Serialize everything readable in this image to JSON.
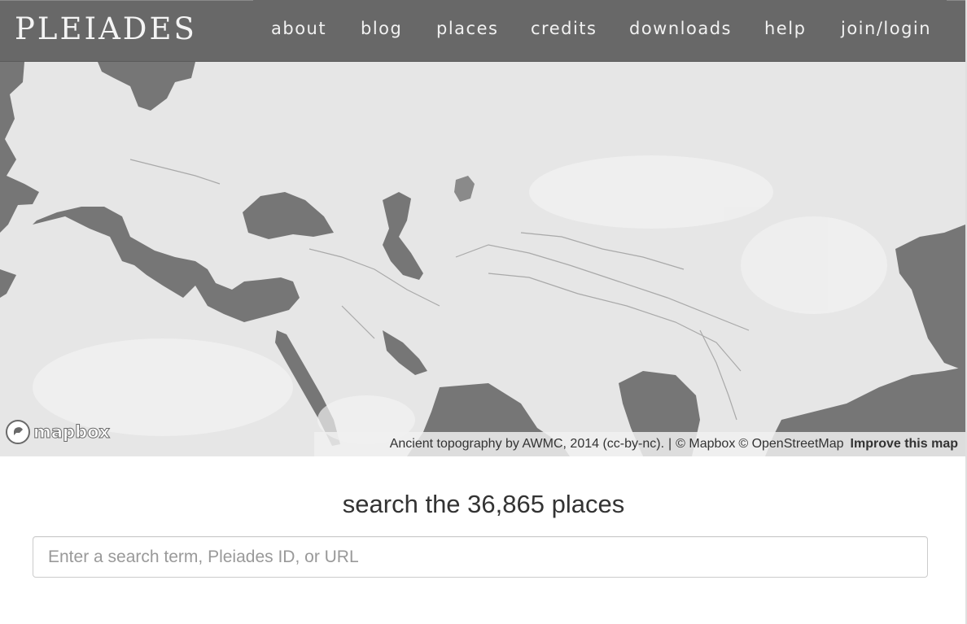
{
  "brand": {
    "logo": "PLEIADES"
  },
  "nav": {
    "items": [
      "about",
      "blog",
      "places",
      "credits",
      "downloads",
      "help",
      "join/login"
    ]
  },
  "map": {
    "logo_text": "mapbox",
    "attribution": {
      "topography": "Ancient topography by AWMC, 2014 (cc-by-nc).",
      "separator": "|",
      "mapbox": "© Mapbox",
      "osm": "© OpenStreetMap",
      "improve": "Improve this map"
    }
  },
  "search": {
    "title": "search the 36,865 places",
    "placeholder": "Enter a search term, Pleiades ID, or URL",
    "value": ""
  },
  "colors": {
    "header_bg": "#686868",
    "land": "#e6e6e6",
    "water": "#767676",
    "text": "#333333"
  }
}
